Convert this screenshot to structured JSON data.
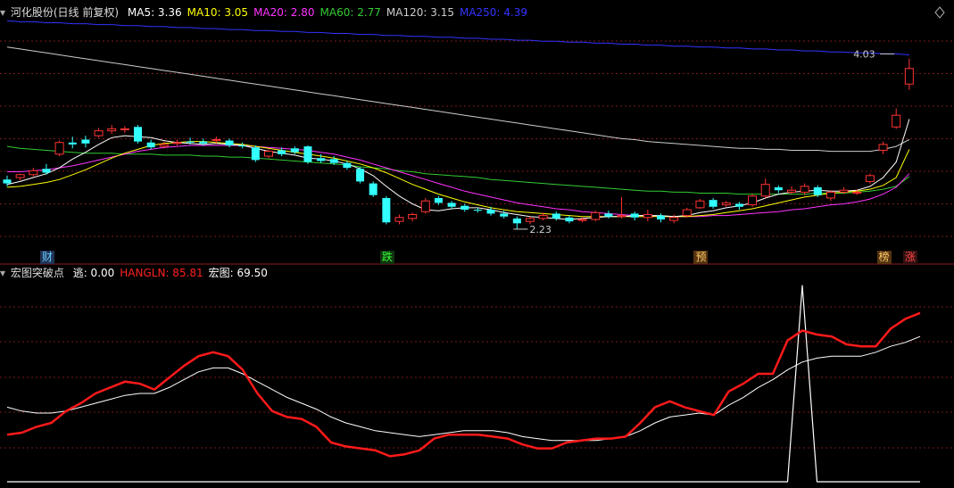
{
  "main_header": {
    "title": "河化股份(日线 前复权)",
    "indicators": [
      {
        "label": "MA5: 3.36",
        "color": "#ffffff"
      },
      {
        "label": "MA10: 3.05",
        "color": "#ffff00"
      },
      {
        "label": "MA20: 2.80",
        "color": "#ff33ff"
      },
      {
        "label": "MA60: 2.77",
        "color": "#33cc33"
      },
      {
        "label": "MA120: 3.15",
        "color": "#cccccc"
      },
      {
        "label": "MA250: 4.39",
        "color": "#3333ff"
      }
    ]
  },
  "sub_header": {
    "title": "宏图突破点",
    "indicators": [
      {
        "label": "逃: 0.00",
        "color": "#ffffff"
      },
      {
        "label": "HANGLN: 85.81",
        "color": "#ff2222"
      },
      {
        "label": "宏图: 69.50",
        "color": "#ffffff"
      }
    ]
  },
  "markers": [
    {
      "text": "财",
      "color": "#66ccff",
      "bg": "#223355"
    },
    {
      "text": "跌",
      "color": "#33ff33",
      "bg": "#113311"
    },
    {
      "text": "预",
      "color": "#ffcc66",
      "bg": "#553311"
    },
    {
      "text": "榜",
      "color": "#ffcc66",
      "bg": "#553311"
    },
    {
      "text": "涨",
      "color": "#ff4444",
      "bg": "#331111"
    }
  ],
  "colors": {
    "up": "#ff3333",
    "down": "#33ffff",
    "grid": "#7a1a1a",
    "ma5": "#ffffff",
    "ma10": "#ffff00",
    "ma20": "#ff33ff",
    "ma60": "#33cc33",
    "ma120": "#cccccc",
    "ma250": "#3333ff",
    "hangln": "#ff1a1a",
    "hongtu": "#ffffff",
    "tao": "#ffffff"
  },
  "chart_data": [
    {
      "type": "candlestick",
      "title": "河化股份(日线 前复权)",
      "ylim": [
        2.0,
        4.4
      ],
      "annotations": [
        {
          "text": "4.03",
          "index": 68,
          "value": 4.03
        },
        {
          "text": "2.23",
          "index": 39,
          "value": 2.23
        }
      ],
      "candles": [
        [
          2.74,
          2.7,
          2.78,
          2.67
        ],
        [
          2.76,
          2.79,
          2.8,
          2.73
        ],
        [
          2.79,
          2.83,
          2.86,
          2.77
        ],
        [
          2.85,
          2.81,
          2.9,
          2.79
        ],
        [
          3.0,
          3.12,
          3.14,
          2.98
        ],
        [
          3.12,
          3.1,
          3.18,
          3.06
        ],
        [
          3.15,
          3.11,
          3.19,
          3.07
        ],
        [
          3.19,
          3.24,
          3.27,
          3.17
        ],
        [
          3.24,
          3.26,
          3.3,
          3.21
        ],
        [
          3.26,
          3.26,
          3.29,
          3.22
        ],
        [
          3.28,
          3.13,
          3.3,
          3.11
        ],
        [
          3.12,
          3.07,
          3.15,
          3.05
        ],
        [
          3.08,
          3.1,
          3.13,
          3.06
        ],
        [
          3.11,
          3.12,
          3.15,
          3.09
        ],
        [
          3.13,
          3.12,
          3.17,
          3.1
        ],
        [
          3.13,
          3.11,
          3.16,
          3.09
        ],
        [
          3.14,
          3.15,
          3.18,
          3.11
        ],
        [
          3.14,
          3.09,
          3.16,
          3.07
        ],
        [
          3.09,
          3.08,
          3.12,
          3.06
        ],
        [
          3.07,
          2.94,
          3.09,
          2.92
        ],
        [
          2.98,
          3.03,
          3.05,
          2.96
        ],
        [
          3.04,
          3.0,
          3.07,
          2.98
        ],
        [
          3.06,
          3.02,
          3.08,
          3.0
        ],
        [
          3.08,
          2.92,
          3.09,
          2.9
        ],
        [
          2.96,
          2.93,
          3.0,
          2.91
        ],
        [
          2.95,
          2.91,
          2.98,
          2.89
        ],
        [
          2.91,
          2.86,
          2.93,
          2.84
        ],
        [
          2.85,
          2.72,
          2.87,
          2.7
        ],
        [
          2.7,
          2.58,
          2.72,
          2.56
        ],
        [
          2.55,
          2.3,
          2.57,
          2.28
        ],
        [
          2.31,
          2.35,
          2.38,
          2.28
        ],
        [
          2.34,
          2.38,
          2.4,
          2.31
        ],
        [
          2.41,
          2.52,
          2.55,
          2.39
        ],
        [
          2.55,
          2.5,
          2.57,
          2.48
        ],
        [
          2.5,
          2.46,
          2.52,
          2.44
        ],
        [
          2.47,
          2.43,
          2.49,
          2.41
        ],
        [
          2.43,
          2.42,
          2.45,
          2.4
        ],
        [
          2.43,
          2.39,
          2.46,
          2.37
        ],
        [
          2.39,
          2.36,
          2.42,
          2.34
        ],
        [
          2.34,
          2.29,
          2.36,
          2.23
        ],
        [
          2.31,
          2.34,
          2.36,
          2.28
        ],
        [
          2.34,
          2.37,
          2.4,
          2.32
        ],
        [
          2.39,
          2.34,
          2.41,
          2.32
        ],
        [
          2.35,
          2.31,
          2.37,
          2.29
        ],
        [
          2.32,
          2.33,
          2.35,
          2.3
        ],
        [
          2.33,
          2.4,
          2.42,
          2.31
        ],
        [
          2.39,
          2.36,
          2.42,
          2.34
        ],
        [
          2.36,
          2.37,
          2.56,
          2.34
        ],
        [
          2.39,
          2.35,
          2.41,
          2.32
        ],
        [
          2.35,
          2.38,
          2.43,
          2.31
        ],
        [
          2.37,
          2.33,
          2.39,
          2.3
        ],
        [
          2.32,
          2.35,
          2.38,
          2.29
        ],
        [
          2.37,
          2.43,
          2.45,
          2.35
        ],
        [
          2.45,
          2.52,
          2.54,
          2.44
        ],
        [
          2.53,
          2.46,
          2.55,
          2.44
        ],
        [
          2.48,
          2.5,
          2.52,
          2.46
        ],
        [
          2.49,
          2.46,
          2.51,
          2.43
        ],
        [
          2.48,
          2.57,
          2.59,
          2.46
        ],
        [
          2.57,
          2.69,
          2.75,
          2.55
        ],
        [
          2.66,
          2.63,
          2.68,
          2.6
        ],
        [
          2.61,
          2.63,
          2.67,
          2.59
        ],
        [
          2.61,
          2.67,
          2.7,
          2.58
        ],
        [
          2.66,
          2.58,
          2.68,
          2.56
        ],
        [
          2.55,
          2.61,
          2.63,
          2.52
        ],
        [
          2.61,
          2.63,
          2.66,
          2.59
        ],
        [
          2.6,
          2.61,
          2.64,
          2.58
        ],
        [
          2.72,
          2.78,
          2.8,
          2.7
        ],
        [
          3.04,
          3.1,
          3.13,
          3.0
        ],
        [
          3.28,
          3.4,
          3.47,
          3.26
        ],
        [
          3.72,
          3.88,
          3.98,
          3.66
        ]
      ],
      "ma5": [
        2.69,
        2.72,
        2.76,
        2.8,
        2.86,
        2.95,
        3.02,
        3.1,
        3.17,
        3.19,
        3.18,
        3.17,
        3.14,
        3.12,
        3.11,
        3.1,
        3.11,
        3.1,
        3.09,
        3.06,
        3.03,
        3.01,
        2.99,
        2.96,
        2.95,
        2.93,
        2.9,
        2.85,
        2.78,
        2.67,
        2.57,
        2.49,
        2.43,
        2.42,
        2.44,
        2.45,
        2.45,
        2.43,
        2.4,
        2.38,
        2.36,
        2.35,
        2.34,
        2.33,
        2.34,
        2.35,
        2.36,
        2.36,
        2.37,
        2.37,
        2.37,
        2.36,
        2.37,
        2.4,
        2.42,
        2.45,
        2.47,
        2.5,
        2.55,
        2.59,
        2.61,
        2.62,
        2.63,
        2.62,
        2.62,
        2.63,
        2.67,
        2.76,
        2.92,
        3.36
      ],
      "ma10": [
        2.66,
        2.67,
        2.69,
        2.71,
        2.74,
        2.79,
        2.84,
        2.9,
        2.96,
        3.01,
        3.05,
        3.09,
        3.11,
        3.12,
        3.13,
        3.13,
        3.12,
        3.11,
        3.1,
        3.08,
        3.06,
        3.04,
        3.02,
        3.0,
        2.98,
        2.96,
        2.93,
        2.9,
        2.86,
        2.81,
        2.75,
        2.69,
        2.64,
        2.59,
        2.55,
        2.51,
        2.48,
        2.45,
        2.43,
        2.41,
        2.4,
        2.39,
        2.38,
        2.37,
        2.36,
        2.36,
        2.36,
        2.36,
        2.36,
        2.36,
        2.36,
        2.36,
        2.36,
        2.37,
        2.38,
        2.4,
        2.42,
        2.44,
        2.47,
        2.5,
        2.53,
        2.56,
        2.58,
        2.6,
        2.61,
        2.62,
        2.64,
        2.68,
        2.76,
        3.05
      ],
      "ma20": [
        2.82,
        2.82,
        2.83,
        2.84,
        2.86,
        2.88,
        2.91,
        2.94,
        2.97,
        3.0,
        3.03,
        3.05,
        3.07,
        3.08,
        3.09,
        3.09,
        3.09,
        3.09,
        3.09,
        3.08,
        3.07,
        3.06,
        3.05,
        3.04,
        3.02,
        3.0,
        2.97,
        2.94,
        2.9,
        2.86,
        2.82,
        2.78,
        2.74,
        2.7,
        2.66,
        2.62,
        2.59,
        2.56,
        2.53,
        2.5,
        2.48,
        2.46,
        2.44,
        2.43,
        2.41,
        2.4,
        2.39,
        2.38,
        2.37,
        2.37,
        2.36,
        2.36,
        2.36,
        2.36,
        2.37,
        2.37,
        2.38,
        2.39,
        2.4,
        2.41,
        2.43,
        2.44,
        2.46,
        2.48,
        2.49,
        2.51,
        2.54,
        2.59,
        2.66,
        2.8
      ],
      "ma60": [
        3.08,
        3.06,
        3.05,
        3.04,
        3.03,
        3.02,
        3.01,
        3.01,
        3.01,
        3.0,
        3.0,
        3.0,
        2.99,
        2.99,
        2.99,
        2.98,
        2.98,
        2.97,
        2.97,
        2.96,
        2.95,
        2.94,
        2.93,
        2.92,
        2.91,
        2.9,
        2.89,
        2.87,
        2.86,
        2.85,
        2.83,
        2.82,
        2.8,
        2.79,
        2.78,
        2.77,
        2.76,
        2.74,
        2.73,
        2.72,
        2.71,
        2.7,
        2.69,
        2.68,
        2.67,
        2.66,
        2.65,
        2.64,
        2.63,
        2.62,
        2.62,
        2.61,
        2.61,
        2.6,
        2.6,
        2.6,
        2.59,
        2.59,
        2.59,
        2.59,
        2.59,
        2.59,
        2.6,
        2.6,
        2.6,
        2.61,
        2.62,
        2.64,
        2.67,
        2.77
      ],
      "ma120": [
        4.1,
        4.08,
        4.06,
        4.04,
        4.02,
        4.0,
        3.98,
        3.96,
        3.94,
        3.92,
        3.9,
        3.88,
        3.86,
        3.84,
        3.82,
        3.8,
        3.78,
        3.76,
        3.74,
        3.72,
        3.7,
        3.68,
        3.66,
        3.64,
        3.62,
        3.6,
        3.58,
        3.56,
        3.54,
        3.52,
        3.5,
        3.48,
        3.46,
        3.44,
        3.42,
        3.4,
        3.38,
        3.36,
        3.34,
        3.32,
        3.3,
        3.28,
        3.26,
        3.24,
        3.22,
        3.2,
        3.18,
        3.16,
        3.15,
        3.13,
        3.12,
        3.11,
        3.1,
        3.09,
        3.08,
        3.07,
        3.06,
        3.06,
        3.05,
        3.05,
        3.04,
        3.04,
        3.04,
        3.03,
        3.03,
        3.03,
        3.03,
        3.05,
        3.08,
        3.15
      ],
      "ma250": [
        4.37,
        4.36,
        4.36,
        4.35,
        4.35,
        4.34,
        4.34,
        4.33,
        4.33,
        4.32,
        4.32,
        4.31,
        4.31,
        4.3,
        4.3,
        4.29,
        4.29,
        4.28,
        4.28,
        4.27,
        4.27,
        4.26,
        4.26,
        4.25,
        4.25,
        4.24,
        4.24,
        4.23,
        4.23,
        4.22,
        4.22,
        4.21,
        4.21,
        4.2,
        4.2,
        4.19,
        4.19,
        4.18,
        4.18,
        4.17,
        4.17,
        4.16,
        4.16,
        4.15,
        4.15,
        4.14,
        4.14,
        4.13,
        4.13,
        4.12,
        4.12,
        4.11,
        4.11,
        4.1,
        4.1,
        4.09,
        4.09,
        4.08,
        4.08,
        4.07,
        4.07,
        4.06,
        4.06,
        4.05,
        4.05,
        4.04,
        4.04,
        4.03,
        4.03,
        4.02
      ],
      "marker_index": [
        3,
        29,
        53,
        67,
        69
      ]
    },
    {
      "type": "line",
      "title": "宏图突破点",
      "ylim": [
        0,
        100
      ],
      "series": [
        {
          "name": "HANGLN",
          "values": [
            24,
            25,
            28,
            30,
            36,
            40,
            45,
            48,
            51,
            50,
            47,
            53,
            59,
            64,
            66,
            64,
            57,
            45,
            36,
            33,
            32,
            28,
            20,
            18,
            17,
            16,
            13,
            14,
            16,
            22,
            24,
            24,
            24,
            23,
            22,
            19,
            17,
            17,
            20,
            21,
            22,
            22,
            23,
            30,
            38,
            41,
            38,
            36,
            34,
            46,
            50,
            55,
            55,
            72,
            77,
            75,
            74,
            70,
            69,
            69,
            78,
            83,
            86
          ]
        },
        {
          "name": "宏图",
          "values": [
            38,
            36,
            35,
            35,
            36,
            38,
            40,
            42,
            44,
            45,
            45,
            48,
            52,
            56,
            58,
            58,
            55,
            51,
            47,
            43,
            40,
            37,
            33,
            30,
            28,
            26,
            25,
            24,
            23,
            24,
            25,
            26,
            26,
            26,
            25,
            23,
            22,
            21,
            21,
            21,
            21,
            22,
            23,
            26,
            30,
            33,
            34,
            35,
            34,
            39,
            43,
            48,
            52,
            57,
            61,
            63,
            64,
            64,
            64,
            66,
            69,
            71,
            74
          ]
        },
        {
          "name": "逃",
          "values": [
            0,
            0,
            0,
            0,
            0,
            0,
            0,
            0,
            0,
            0,
            0,
            0,
            0,
            0,
            0,
            0,
            0,
            0,
            0,
            0,
            0,
            0,
            0,
            0,
            0,
            0,
            0,
            0,
            0,
            0,
            0,
            0,
            0,
            0,
            0,
            0,
            0,
            0,
            0,
            0,
            0,
            0,
            0,
            0,
            0,
            0,
            0,
            0,
            0,
            0,
            0,
            0,
            0,
            0,
            100,
            0,
            0,
            0,
            0,
            0,
            0,
            0,
            0
          ]
        }
      ]
    }
  ]
}
